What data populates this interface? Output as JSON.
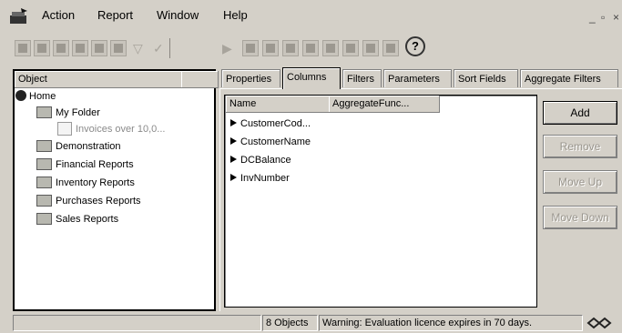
{
  "menubar": {
    "items": [
      "Action",
      "Report",
      "Window",
      "Help"
    ],
    "window_controls": [
      "_",
      "▫",
      "×"
    ]
  },
  "toolbar": {
    "help_icon": "?"
  },
  "left_pane": {
    "column_header": "Object",
    "tree": [
      {
        "label": "Home",
        "icon": "globe-icon",
        "indent": 0
      },
      {
        "label": "My Folder",
        "icon": "folder-icon",
        "indent": 1
      },
      {
        "label": "Invoices over 10,0...",
        "icon": "report-icon",
        "indent": 2
      },
      {
        "label": "Demonstration",
        "icon": "folder-icon",
        "indent": 1
      },
      {
        "label": "Financial Reports",
        "icon": "folder-icon",
        "indent": 1
      },
      {
        "label": "Inventory Reports",
        "icon": "folder-icon",
        "indent": 1
      },
      {
        "label": "Purchases Reports",
        "icon": "folder-icon",
        "indent": 1
      },
      {
        "label": "Sales Reports",
        "icon": "folder-icon",
        "indent": 1
      }
    ]
  },
  "tabs": {
    "labels": [
      "Properties",
      "Columns",
      "Filters",
      "Parameters",
      "Sort Fields",
      "Aggregate Filters"
    ],
    "active": "Columns"
  },
  "columns_list": {
    "headers": [
      "Name",
      "AggregateFunc..."
    ],
    "rows": [
      "CustomerCod...",
      "CustomerName",
      "DCBalance",
      "InvNumber"
    ]
  },
  "side_buttons": {
    "add": "Add",
    "remove": "Remove",
    "move_up": "Move Up",
    "move_down": "Move Down"
  },
  "statusbar": {
    "object_count": "8 Objects",
    "warning": "Warning: Evaluation licence expires in 70 days."
  }
}
